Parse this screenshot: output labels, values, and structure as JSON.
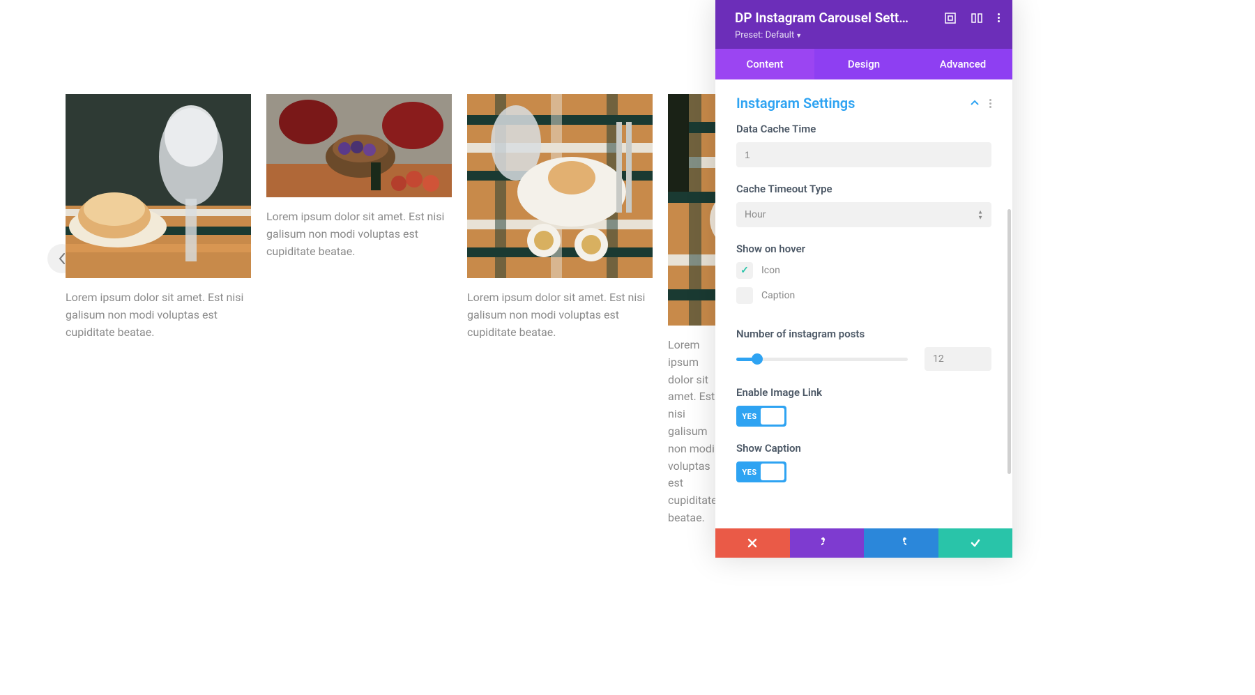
{
  "carousel": {
    "items": [
      {
        "caption": "Lorem ipsum dolor sit amet. Est nisi galisum non modi voluptas est cupiditate beatae."
      },
      {
        "caption": "Lorem ipsum dolor sit amet. Est nisi galisum non modi voluptas est cupiditate beatae."
      },
      {
        "caption": "Lorem ipsum dolor sit amet. Est nisi galisum non modi voluptas est cupiditate beatae."
      },
      {
        "caption": "Lorem ipsum dolor sit amet. Est nisi galisum non modi voluptas est cupiditate beatae."
      }
    ]
  },
  "panel": {
    "title": "DP Instagram Carousel Sett…",
    "preset_label": "Preset: Default",
    "tabs": {
      "content": "Content",
      "design": "Design",
      "advanced": "Advanced",
      "active": "content"
    },
    "section_title": "Instagram Settings",
    "fields": {
      "data_cache_time": {
        "label": "Data Cache Time",
        "value": "1"
      },
      "cache_timeout_type": {
        "label": "Cache Timeout Type",
        "value": "Hour"
      },
      "show_on_hover": {
        "label": "Show on hover",
        "icon_label": "Icon",
        "icon_checked": true,
        "caption_label": "Caption",
        "caption_checked": false
      },
      "num_posts": {
        "label": "Number of instagram posts",
        "value": "12"
      },
      "enable_image_link": {
        "label": "Enable Image Link",
        "value": "YES"
      },
      "show_caption": {
        "label": "Show Caption",
        "value": "YES"
      }
    }
  },
  "colors": {
    "header_bg": "#6c2eb9",
    "tab_bg": "#8e3ff2",
    "tab_active": "#9b45f2",
    "accent": "#2ea3f2",
    "success": "#29c4a9",
    "danger": "#ea5a47",
    "undo": "#7e3bd0",
    "redo": "#2b87da"
  }
}
